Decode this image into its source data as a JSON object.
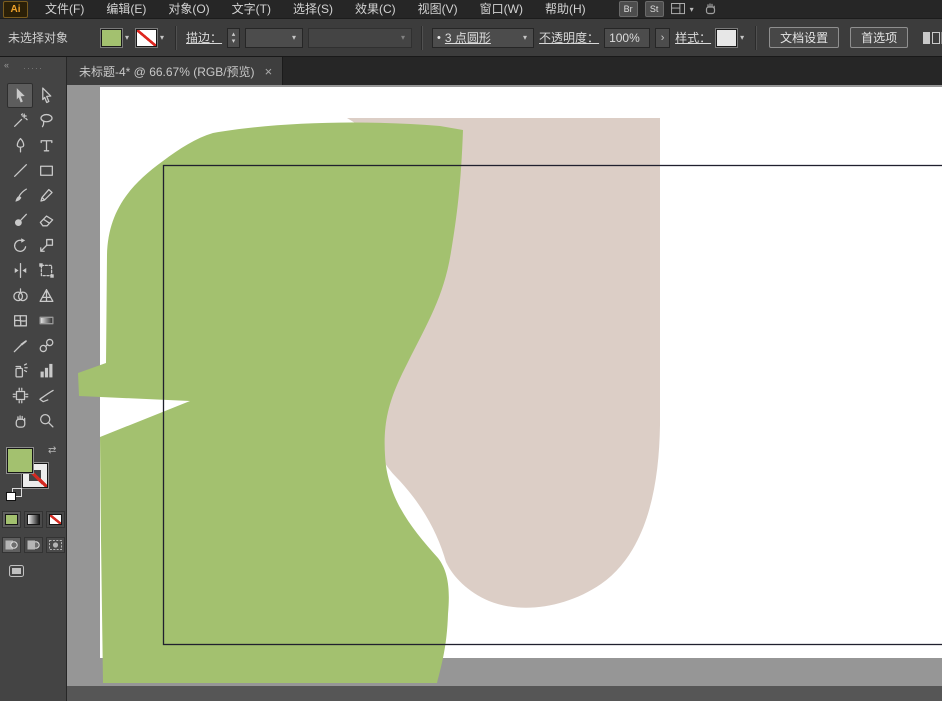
{
  "glyphs": {
    "dd": "▾",
    "spin_up": "▴",
    "spin_down": "▾",
    "panel_arrow": "›",
    "close": "×",
    "collapse": "«",
    "grip": "·····",
    "swap": "⇄",
    "bullet": "•"
  },
  "app": {
    "logo_text": "Ai"
  },
  "menubar": {
    "items": [
      {
        "label": "文件(F)"
      },
      {
        "label": "编辑(E)"
      },
      {
        "label": "对象(O)"
      },
      {
        "label": "文字(T)"
      },
      {
        "label": "选择(S)"
      },
      {
        "label": "效果(C)"
      },
      {
        "label": "视图(V)"
      },
      {
        "label": "窗口(W)"
      },
      {
        "label": "帮助(H)"
      }
    ],
    "bridge_label": "Br",
    "stock_label": "St"
  },
  "controlbar": {
    "no_selection_label": "未选择对象",
    "stroke_label": "描边：",
    "brush_name": "3 点圆形",
    "opacity_label": "不透明度：",
    "opacity_value": "100%",
    "style_label": "样式：",
    "document_setup_label": "文档设置",
    "preferences_label": "首选项"
  },
  "tabbar": {
    "title": "未标题-4* @ 66.67% (RGB/预览)"
  },
  "toolbar": {
    "tools": [
      "selection",
      "direct-selection",
      "magic-wand",
      "lasso",
      "pen",
      "type",
      "line-segment",
      "rectangle",
      "paintbrush",
      "pencil",
      "blob-brush",
      "eraser",
      "rotate",
      "scale",
      "width",
      "free-transform",
      "shape-builder",
      "perspective-grid",
      "mesh",
      "gradient",
      "eyedropper",
      "blend",
      "symbol-sprayer",
      "column-graph",
      "artboard",
      "slice",
      "hand",
      "zoom"
    ],
    "active_tool": "selection"
  },
  "colors": {
    "fill_swatch": "#a3c16f",
    "green_shape": "#a3c16f",
    "beige_shape": "#dccec6",
    "pasteboard": "#969696",
    "artboard": "#ffffff",
    "rect_stroke": "#20202e",
    "bottom_strip": "#565656"
  }
}
